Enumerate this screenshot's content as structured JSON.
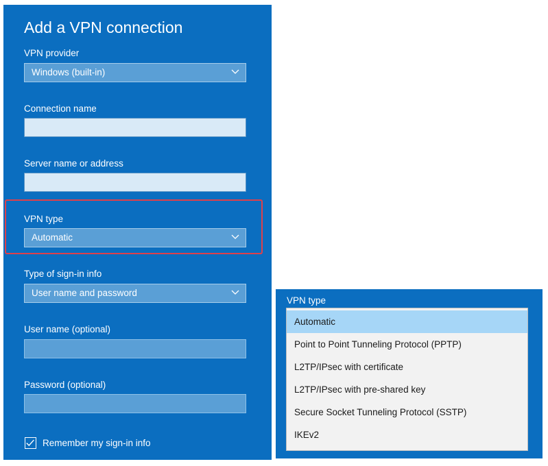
{
  "form": {
    "title": "Add a VPN connection",
    "vpn_provider": {
      "label": "VPN provider",
      "value": "Windows (built-in)"
    },
    "connection_name": {
      "label": "Connection name",
      "value": ""
    },
    "server": {
      "label": "Server name or address",
      "value": ""
    },
    "vpn_type": {
      "label": "VPN type",
      "value": "Automatic"
    },
    "signin_type": {
      "label": "Type of sign-in info",
      "value": "User name and password"
    },
    "username": {
      "label": "User name (optional)",
      "value": ""
    },
    "password": {
      "label": "Password (optional)",
      "value": ""
    },
    "remember": {
      "label": "Remember my sign-in info",
      "checked": true
    }
  },
  "dropdown": {
    "label": "VPN type",
    "options": [
      "Automatic",
      "Point to Point Tunneling Protocol (PPTP)",
      "L2TP/IPsec with certificate",
      "L2TP/IPsec with pre-shared key",
      "Secure Socket Tunneling Protocol (SSTP)",
      "IKEv2"
    ],
    "selected": "Automatic"
  },
  "colors": {
    "panel": "#0b6ec0",
    "highlight": "#e0404a",
    "selected_option": "#a6d6f7"
  },
  "icons": [
    "chevron-down-icon",
    "checkmark-icon"
  ]
}
